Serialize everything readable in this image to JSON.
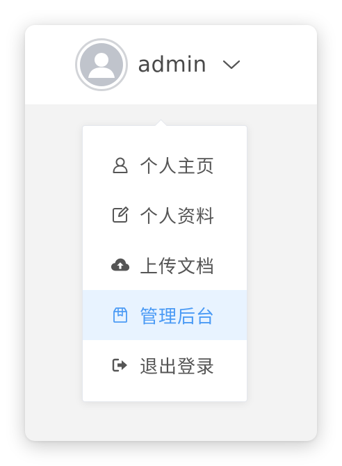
{
  "header": {
    "username": "admin",
    "avatar_icon": "user-avatar-icon",
    "dropdown_icon": "chevron-down-icon"
  },
  "menu": {
    "items": [
      {
        "label": "个人主页",
        "icon": "user-outline-icon",
        "active": false
      },
      {
        "label": "个人资料",
        "icon": "edit-icon",
        "active": false
      },
      {
        "label": "上传文档",
        "icon": "cloud-upload-icon",
        "active": false
      },
      {
        "label": "管理后台",
        "icon": "box-icon",
        "active": true
      },
      {
        "label": "退出登录",
        "icon": "sign-out-icon",
        "active": false
      }
    ]
  },
  "colors": {
    "active_text": "#4a9af5",
    "active_bg": "#e8f3ff",
    "avatar_bg": "#c0c4cc",
    "text": "#555555"
  }
}
